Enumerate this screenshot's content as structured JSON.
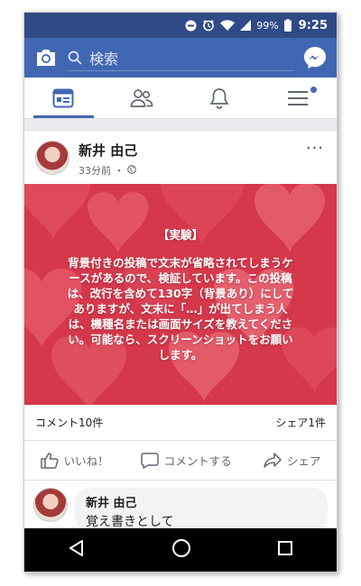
{
  "status_bar": {
    "battery_percent": "99%",
    "time": "9:25",
    "icons": [
      "dnd-icon",
      "alarm-icon",
      "wifi-icon",
      "signal-icon",
      "battery-icon"
    ]
  },
  "header": {
    "search_placeholder": "検索",
    "icons": [
      "camera-icon",
      "search-icon",
      "messenger-icon"
    ]
  },
  "tabs": [
    {
      "name": "news-feed",
      "icon": "news-feed-icon",
      "active": true
    },
    {
      "name": "friends",
      "icon": "friends-icon",
      "active": false
    },
    {
      "name": "notifications",
      "icon": "bell-icon",
      "active": false
    },
    {
      "name": "menu",
      "icon": "menu-icon",
      "active": false,
      "badge": true
    }
  ],
  "post": {
    "author": "新井 由己",
    "time": "33分前 ・",
    "privacy_icon": "globe-icon",
    "more_label": "···",
    "background_color": "#d4384a",
    "text_heading": "【実験】",
    "text_lines": [
      "背景付きの投稿で文末が省略されてしまうケ",
      "ースがあるので、検証しています。この投稿",
      "は、改行を含めて130字（背景あり）にして",
      "ありますが、文末に「…」が出てしまう人",
      "は、機種名または画面サイズを教えてくださ",
      "い。可能なら、スクリーンショットをお願い",
      "します。"
    ],
    "comments_count": "コメント10件",
    "shares_count": "シェア1件",
    "actions": {
      "like": "いいね！",
      "comment": "コメントする",
      "share": "シェア"
    }
  },
  "comment": {
    "author": "新井 由己",
    "text": "覚え書きとして"
  },
  "colors": {
    "status_bar": "#2f4a86",
    "brand": "#4267b2",
    "nav_bar": "#000000"
  }
}
